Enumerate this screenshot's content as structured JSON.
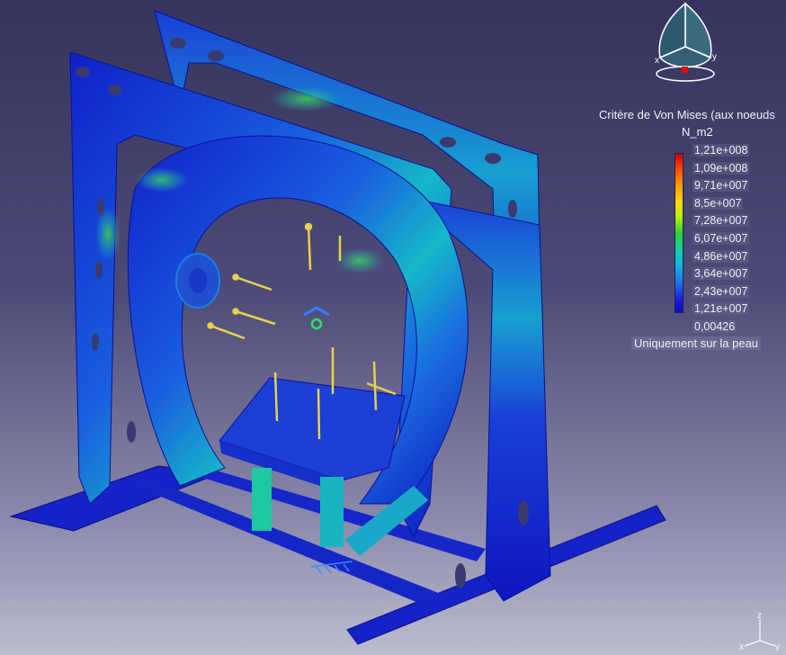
{
  "legend": {
    "title": "Critère de Von Mises (aux noeuds",
    "unit": "N_m2",
    "values": [
      "1,21e+008",
      "1,09e+008",
      "9,71e+007",
      "8,5e+007",
      "7,28e+007",
      "6,07e+007",
      "4,86e+007",
      "3,64e+007",
      "2,43e+007",
      "1,21e+007",
      "0,00426"
    ],
    "note": "Uniquement sur la peau"
  },
  "compass": {
    "x_label": "x",
    "y_label": "y"
  },
  "axis_triad": {
    "x_label": "x",
    "y_label": "y",
    "z_label": "z"
  },
  "colors": {
    "low": "#0c0cb8",
    "mid": "#2bd23a",
    "high": "#d40000",
    "load_arrow": "#e8d24a"
  }
}
